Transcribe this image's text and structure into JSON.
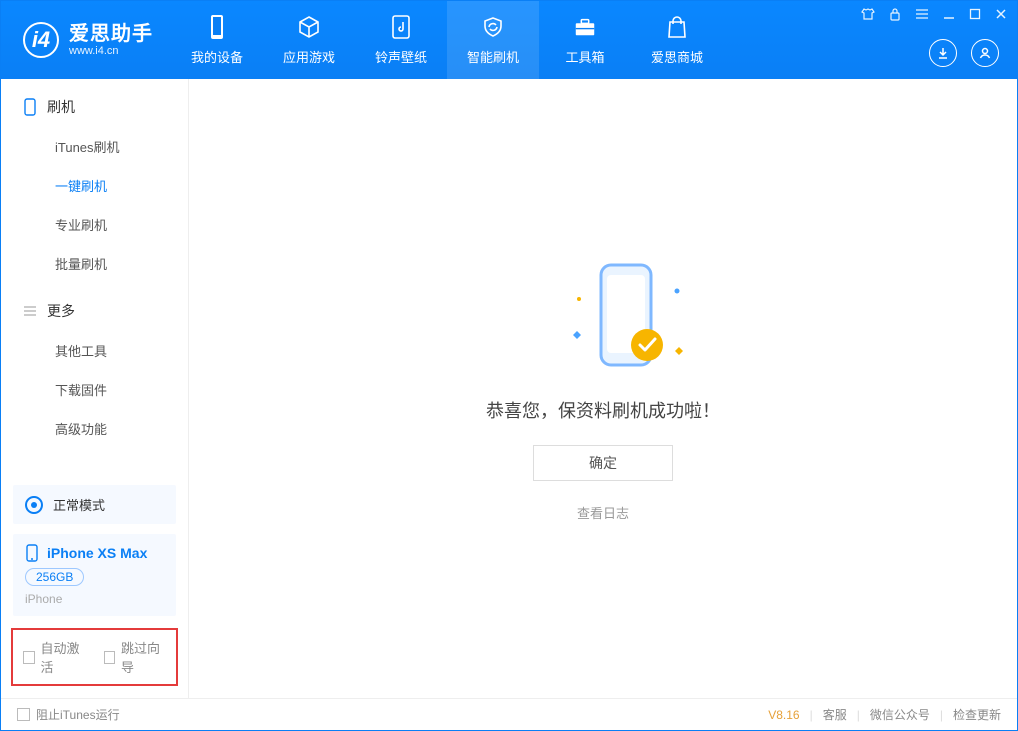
{
  "app": {
    "logo_title": "爱思助手",
    "logo_sub": "www.i4.cn"
  },
  "nav": [
    {
      "label": "我的设备"
    },
    {
      "label": "应用游戏"
    },
    {
      "label": "铃声壁纸"
    },
    {
      "label": "智能刷机",
      "active": true
    },
    {
      "label": "工具箱"
    },
    {
      "label": "爱思商城"
    }
  ],
  "sidebar": {
    "group1": {
      "title": "刷机"
    },
    "items1": [
      {
        "label": "iTunes刷机"
      },
      {
        "label": "一键刷机",
        "active": true
      },
      {
        "label": "专业刷机"
      },
      {
        "label": "批量刷机"
      }
    ],
    "group2": {
      "title": "更多"
    },
    "items2": [
      {
        "label": "其他工具"
      },
      {
        "label": "下载固件"
      },
      {
        "label": "高级功能"
      }
    ],
    "mode_label": "正常模式",
    "device": {
      "name": "iPhone XS Max",
      "capacity": "256GB",
      "type": "iPhone"
    },
    "opts": {
      "auto_activate": "自动激活",
      "skip_guide": "跳过向导"
    }
  },
  "main": {
    "success": "恭喜您，保资料刷机成功啦！",
    "ok": "确定",
    "view_log": "查看日志"
  },
  "status": {
    "block_itunes": "阻止iTunes运行",
    "version": "V8.16",
    "support": "客服",
    "wechat": "微信公众号",
    "update": "检查更新"
  }
}
